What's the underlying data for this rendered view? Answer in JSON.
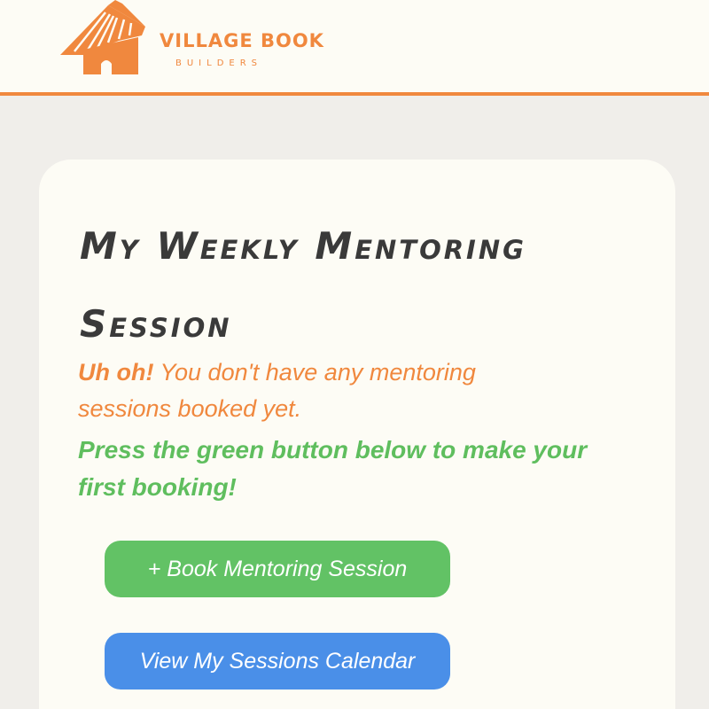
{
  "header": {
    "brand_name": "VILLAGE BOOK",
    "brand_sub": "BUILDERS",
    "logo_icon": "hut-icon"
  },
  "colors": {
    "brand_orange": "#f0883e",
    "success_green": "#5fbe5e",
    "primary_blue": "#4a8fe8",
    "text_dark": "#3a3a3a"
  },
  "card": {
    "title": "My Weekly Mentoring Session",
    "alert_bold": "Uh oh!",
    "alert_text": " You don't have any mentoring sessions booked yet.",
    "instruction": "Press the green button below to make your first booking!",
    "book_button": "+ Book Mentoring Session",
    "calendar_button": "View My Sessions Calendar"
  }
}
